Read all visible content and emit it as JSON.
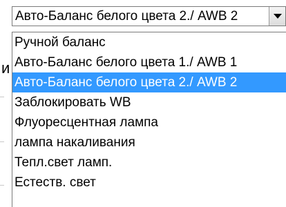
{
  "background": {
    "partial_glyph": "и"
  },
  "select": {
    "value": "Авто-Баланс белого цвета 2./ AWB 2",
    "options": [
      {
        "label": "Ручной баланс",
        "selected": false
      },
      {
        "label": "Авто-Баланс белого цвета 1./ AWB 1",
        "selected": false
      },
      {
        "label": "Авто-Баланс белого цвета 2./ AWB 2",
        "selected": true
      },
      {
        "label": "Заблокировать WB",
        "selected": false
      },
      {
        "label": "Флуоресцентная лампа",
        "selected": false
      },
      {
        "label": "лампа накаливания",
        "selected": false
      },
      {
        "label": "Тепл.свет ламп.",
        "selected": false
      },
      {
        "label": "Естеств. свет",
        "selected": false
      }
    ]
  },
  "colors": {
    "highlight": "#3399ff",
    "highlight_text": "#ffffff",
    "border": "#7a7a7a"
  }
}
